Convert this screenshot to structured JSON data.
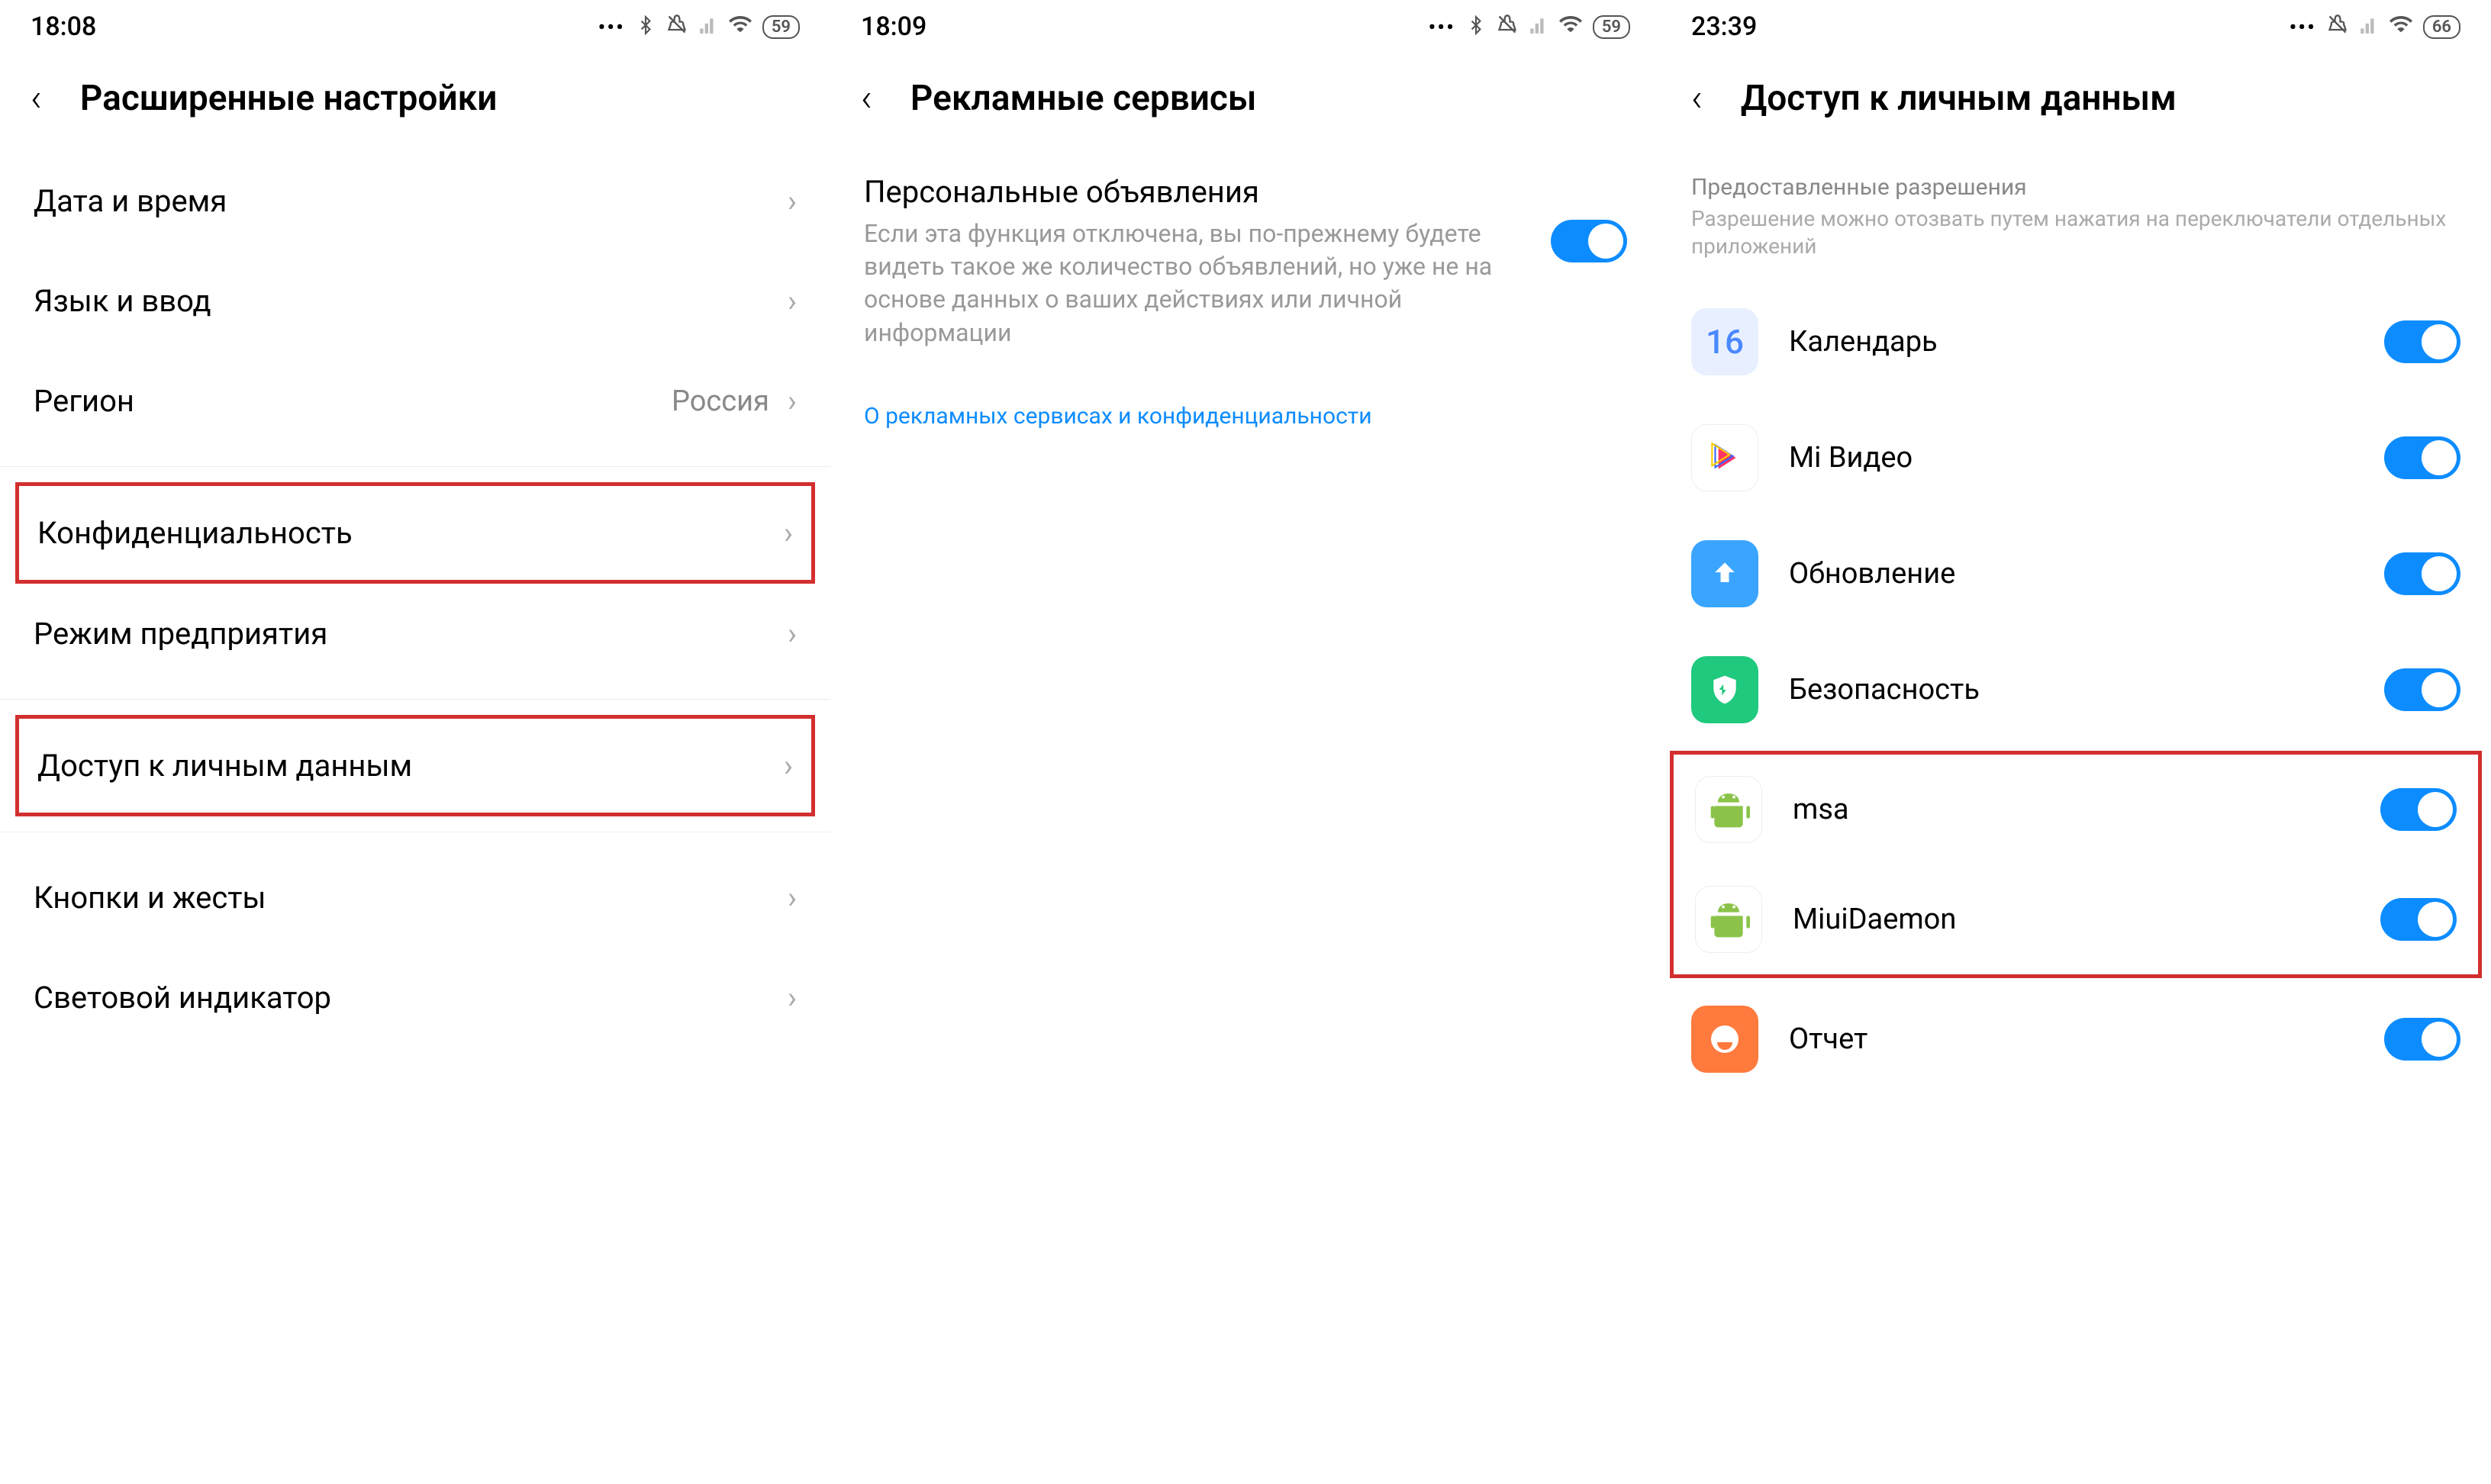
{
  "screen1": {
    "time": "18:08",
    "battery": "59",
    "title": "Расширенные настройки",
    "rows": {
      "datetime": "Дата и время",
      "lang": "Язык и ввод",
      "region": "Регион",
      "region_value": "Россия",
      "privacy": "Конфиденциальность",
      "enterprise": "Режим предприятия",
      "personal_data": "Доступ к личным данным",
      "buttons": "Кнопки и жесты",
      "led": "Световой индикатор"
    }
  },
  "screen2": {
    "time": "18:09",
    "battery": "59",
    "title": "Рекламные сервисы",
    "toggle_title": "Персональные объявления",
    "toggle_desc": "Если эта функция отключена, вы по-прежнему будете видеть такое же количество объявлений, но уже не на основе данных о ваших действиях или личной информации",
    "link": "О рекламных сервисах и конфиденциальности"
  },
  "screen3": {
    "time": "23:39",
    "battery": "66",
    "title": "Доступ к личным данным",
    "section_head": "Предоставленные разрешения",
    "section_sub": "Разрешение можно отозвать путем нажатия на переключатели отдельных приложений",
    "apps": {
      "calendar": "Календарь",
      "calendar_num": "16",
      "mivideo": "Mi Видео",
      "update": "Обновление",
      "security": "Безопасность",
      "msa": "msa",
      "miuidaemon": "MiuiDaemon",
      "report": "Отчет"
    }
  }
}
